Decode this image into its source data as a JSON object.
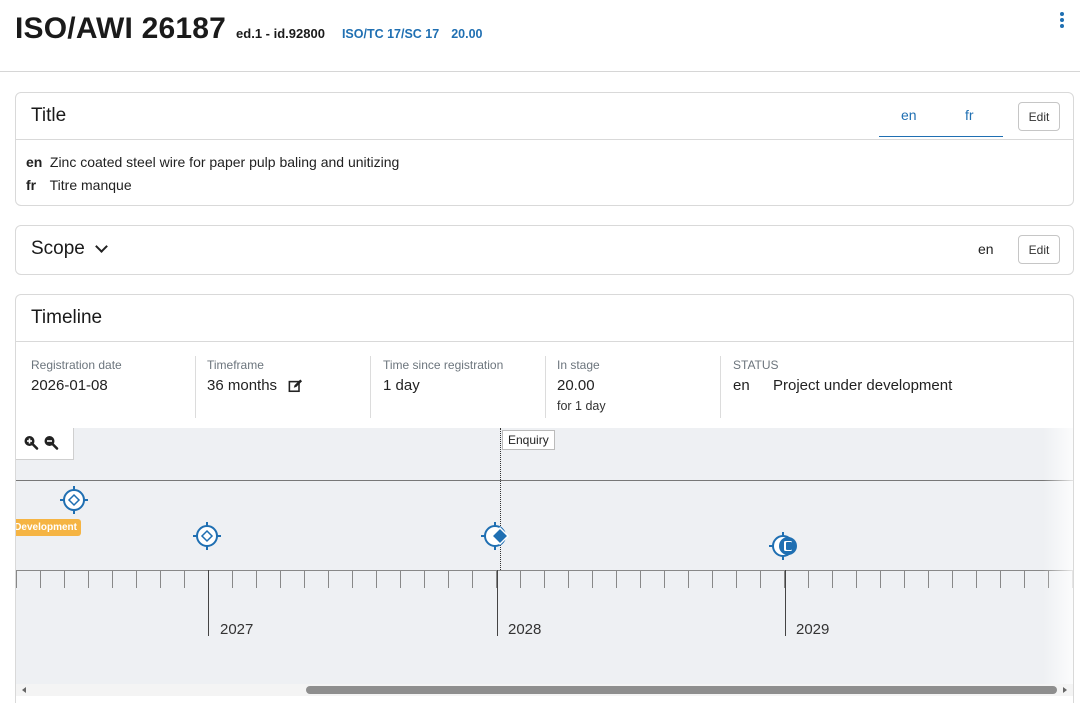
{
  "header": {
    "doc_code": "ISO/AWI 26187",
    "edition": "ed.1 - id.92800",
    "committee": "ISO/TC 17/SC 17",
    "stage": "20.00",
    "menu_icon": "kebab-menu-icon"
  },
  "title_card": {
    "heading": "Title",
    "tabs": [
      "en",
      "fr"
    ],
    "edit_label": "Edit",
    "rows": [
      {
        "lang": "en",
        "text": "Zinc coated steel wire for paper pulp baling and unitizing"
      },
      {
        "lang": "fr",
        "text": "Titre manque"
      }
    ]
  },
  "scope_card": {
    "heading": "Scope",
    "lang": "en",
    "edit_label": "Edit"
  },
  "timeline_card": {
    "heading": "Timeline",
    "registration": {
      "label": "Registration date",
      "value": "2026-01-08"
    },
    "timeframe": {
      "label": "Timeframe",
      "value": "36 months"
    },
    "time_since": {
      "label": "Time since registration",
      "value": "1 day"
    },
    "in_stage": {
      "label": "In stage",
      "value": "20.00",
      "sub": "for 1 day"
    },
    "status": {
      "label": "STATUS",
      "lang": "en",
      "value": "Project under development"
    },
    "enquiry_label": "Enquiry",
    "dev_badge": "Development",
    "years": [
      "2027",
      "2028",
      "2029"
    ]
  },
  "colors": {
    "accent": "#1f6fb2",
    "badge": "#f5b443"
  }
}
